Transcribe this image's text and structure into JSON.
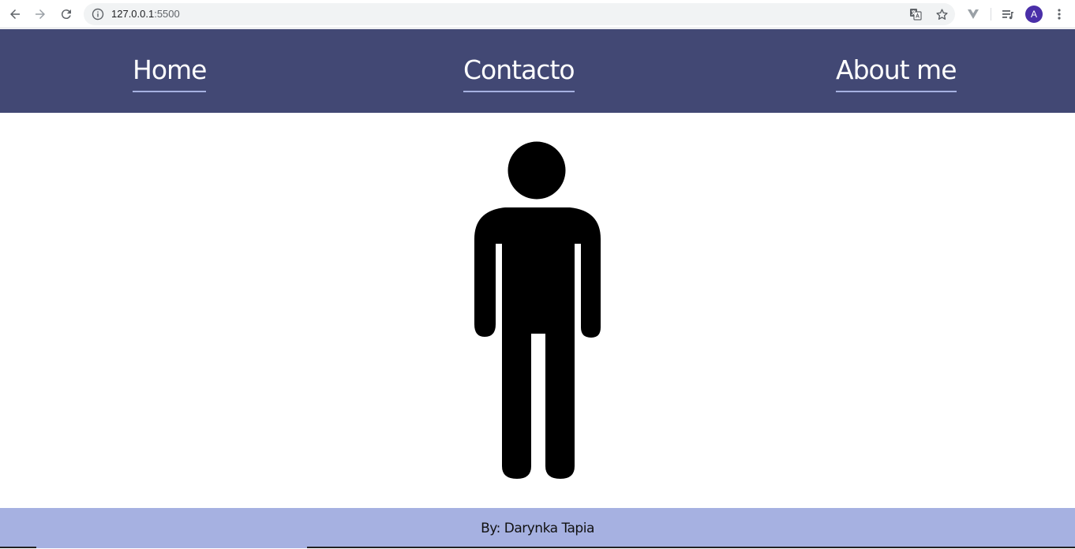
{
  "browser": {
    "url_host": "127.0.0.1",
    "url_port": ":5500",
    "avatar_letter": "A",
    "icons": [
      "back-arrow-icon",
      "forward-arrow-icon",
      "reload-icon",
      "info-icon",
      "translate-icon",
      "star-icon",
      "extension-icon",
      "media-queue-icon",
      "menu-dots-icon"
    ]
  },
  "nav": {
    "items": [
      {
        "label": "Home"
      },
      {
        "label": "Contacto"
      },
      {
        "label": "About me"
      }
    ]
  },
  "main": {
    "figure_icon": "person-icon"
  },
  "footer": {
    "text": "By: Darynka Tapia"
  },
  "colors": {
    "nav_bg": "#424874",
    "nav_underline": "#a6b1e1",
    "footer_bg": "#a6b1e1",
    "avatar_bg": "#4a2fa8"
  }
}
